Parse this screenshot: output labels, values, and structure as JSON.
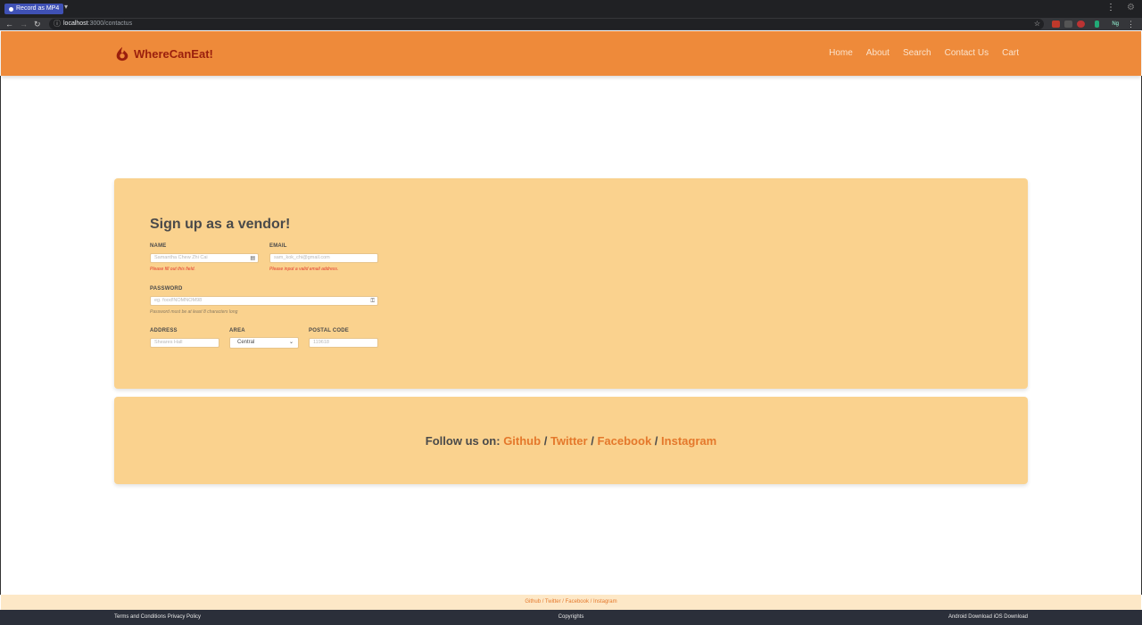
{
  "browser": {
    "recorder_label": "Record as MP4",
    "url_host": "localhost",
    "url_rest": ":3000/contactus",
    "profile_badge": "Ng"
  },
  "header": {
    "brand": "WhereCanEat!",
    "nav": [
      "Home",
      "About",
      "Search",
      "Contact Us",
      "Cart"
    ]
  },
  "form": {
    "title": "Sign up as a vendor!",
    "name": {
      "label": "NAME",
      "placeholder": "Samantha Chew Zhi Cai",
      "error": "Please fill out this field."
    },
    "email": {
      "label": "EMAIL",
      "placeholder": "sam_kok_chi@gmail.com",
      "error": "Please input a valid email address."
    },
    "password": {
      "label": "PASSWORD",
      "placeholder": "eg. food!NOMNOM98",
      "hint": "Password must be at least 8 characters long"
    },
    "address": {
      "label": "ADDRESS",
      "placeholder": "Sheares Hall"
    },
    "area": {
      "label": "AREA",
      "selected": "Central"
    },
    "postal": {
      "label": "POSTAL CODE",
      "placeholder": "119618"
    }
  },
  "follow": {
    "prefix": "Follow us on:",
    "links": [
      "Github",
      "Twitter",
      "Facebook",
      "Instagram"
    ],
    "sep": "/"
  },
  "footer": {
    "links_line": "Github / Twitter / Facebook / Instagram",
    "left": "Terms and Conditions Privacy Policy",
    "middle": "Copyrights",
    "right": "Android Download iOS Download"
  },
  "colors": {
    "header": "#ee8a3a",
    "card": "#fad28e",
    "accent": "#e4782b",
    "brand": "#9a1f0d"
  }
}
